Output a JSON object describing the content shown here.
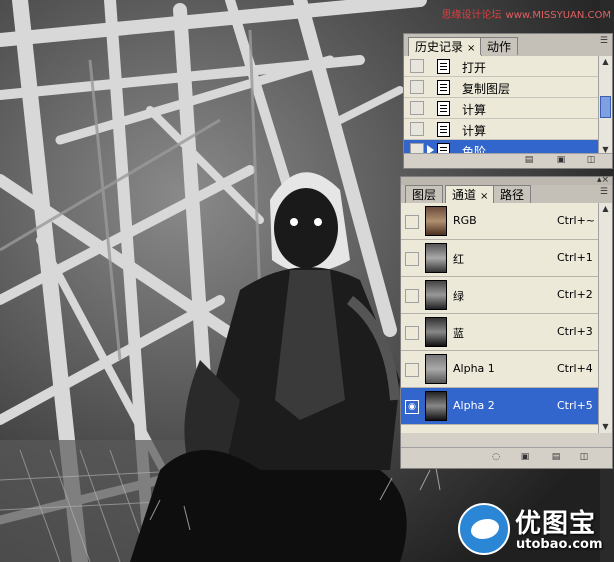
{
  "watermark_top": {
    "text": "思缘设计论坛",
    "site": "www.MISSYUAN.COM"
  },
  "history_panel": {
    "tabs": [
      {
        "label": "历史记录",
        "close": "×"
      },
      {
        "label": "动作"
      }
    ],
    "items": [
      {
        "label": "打开"
      },
      {
        "label": "复制图层"
      },
      {
        "label": "计算"
      },
      {
        "label": "计算"
      },
      {
        "label": "色阶",
        "selected": true
      }
    ]
  },
  "channels_panel": {
    "tabs": [
      {
        "label": "图层"
      },
      {
        "label": "通道",
        "close": "×"
      },
      {
        "label": "路径"
      }
    ],
    "channels": [
      {
        "name": "RGB",
        "shortcut": "Ctrl+~"
      },
      {
        "name": "红",
        "shortcut": "Ctrl+1"
      },
      {
        "name": "绿",
        "shortcut": "Ctrl+2"
      },
      {
        "name": "蓝",
        "shortcut": "Ctrl+3"
      },
      {
        "name": "Alpha 1",
        "shortcut": "Ctrl+4"
      },
      {
        "name": "Alpha 2",
        "shortcut": "Ctrl+5",
        "selected": true,
        "visible": true
      }
    ]
  },
  "logo": {
    "brand": "优图宝",
    "domain": "utobao.com"
  },
  "colors": {
    "selection": "#3366cc",
    "panel": "#d4d0c8",
    "list": "#ece9d8"
  }
}
